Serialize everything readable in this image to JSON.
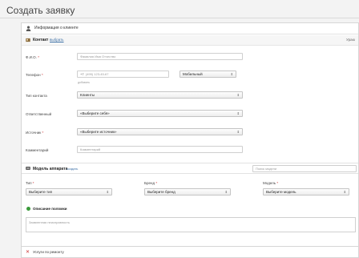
{
  "page": {
    "title": "Создать заявку"
  },
  "client_section": {
    "title": "Информация о клиенте",
    "contact_bar": {
      "label": "Контакт",
      "link": "выбрать",
      "right_text": "Ураю"
    },
    "fio": {
      "label": "Ф.И.О.",
      "required_mark": "*",
      "placeholder": "Фамилия Имя Отчество"
    },
    "phone": {
      "label": "Телефон",
      "required_mark": "*",
      "prefix": "+7",
      "placeholder": "(495) 123-45-67",
      "type_value": "Мобильный",
      "hint": "добавить"
    },
    "contact_type": {
      "label": "Тип контакта",
      "value": "Клиенты"
    },
    "responsible": {
      "label": "Ответственный",
      "value": "«Выберите себя»"
    },
    "executor": {
      "label": "Источник",
      "required_mark": "*",
      "value": "«Выберите источник»"
    },
    "comment": {
      "label": "Комментарий",
      "placeholder": "Комментарий"
    }
  },
  "model_section": {
    "title": "Модель аппарата",
    "link": "создать",
    "search_placeholder": "Поиск модели",
    "type": {
      "label": "Тип",
      "required_mark": "*",
      "value": "Выберите тип"
    },
    "brand": {
      "label": "Бренд",
      "required_mark": "*",
      "value": "Выберите бренд"
    },
    "model": {
      "label": "Модель",
      "required_mark": "*",
      "value": "Выберите модель"
    },
    "defect": {
      "title": "Описание поломки",
      "placeholder": "Заявленная неисправность"
    }
  },
  "services_section": {
    "title": "Услуги по ремонту"
  },
  "icons": {
    "person": "person-icon",
    "contact": "contact-card-icon",
    "device": "device-icon",
    "wrench": "tools-icon",
    "select_arrows": "⇕"
  },
  "colors": {
    "link": "#3a6ea5",
    "required": "#cc3333",
    "status_dot": "#3a9a3a"
  }
}
